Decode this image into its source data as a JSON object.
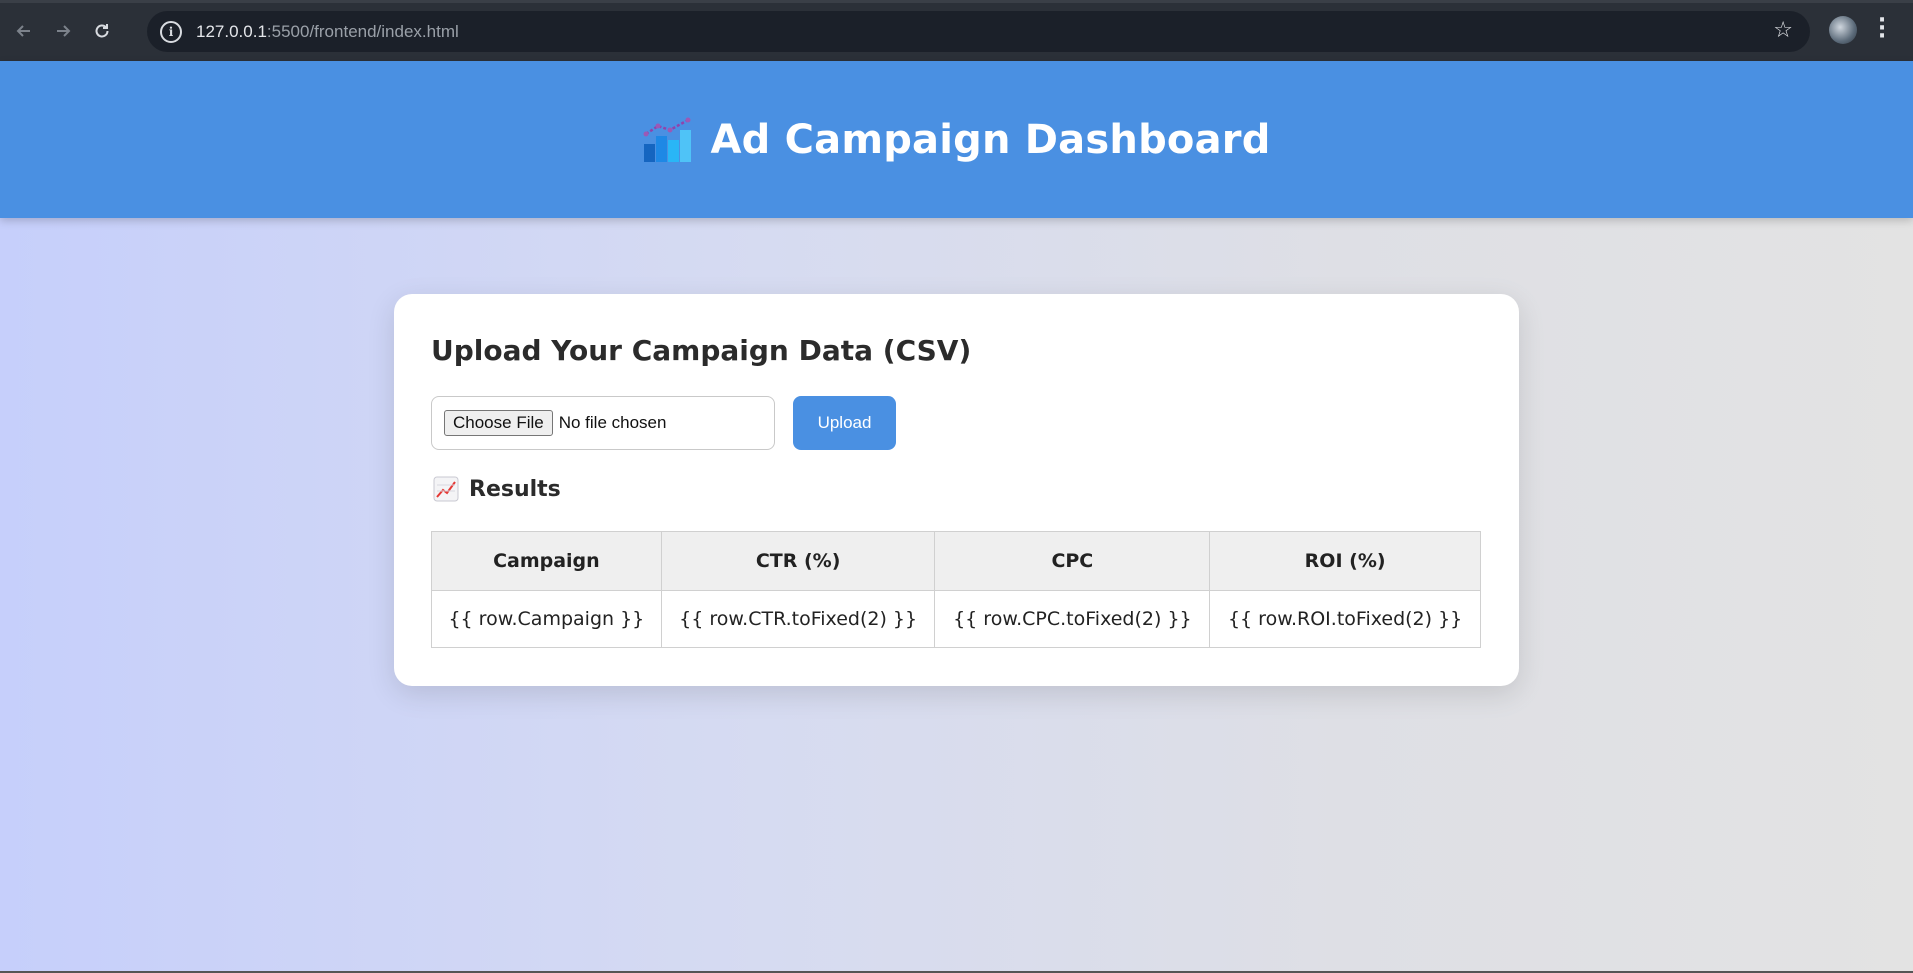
{
  "browser": {
    "back_icon": "arrow-left-icon",
    "forward_icon": "arrow-right-icon",
    "reload_icon": "reload-icon",
    "url_host": "127.0.0.1",
    "url_port_path": ":5500/frontend/index.html",
    "bookmark_icon": "star-icon",
    "menu_icon": "kebab-menu-icon"
  },
  "header": {
    "title": "Ad Campaign Dashboard",
    "icon": "bar-chart-icon",
    "background": "#4a90e2"
  },
  "upload": {
    "heading": "Upload Your Campaign Data (CSV)",
    "choose_label": "Choose File",
    "file_status": "No file chosen",
    "upload_label": "Upload"
  },
  "results": {
    "icon": "chart-increasing-icon",
    "heading": "Results",
    "columns": [
      "Campaign",
      "CTR (%)",
      "CPC",
      "ROI (%)"
    ],
    "rows": [
      [
        "{{ row.Campaign }}",
        "{{ row.CTR.toFixed(2) }}",
        "{{ row.CPC.toFixed(2) }}",
        "{{ row.ROI.toFixed(2) }}"
      ]
    ]
  }
}
